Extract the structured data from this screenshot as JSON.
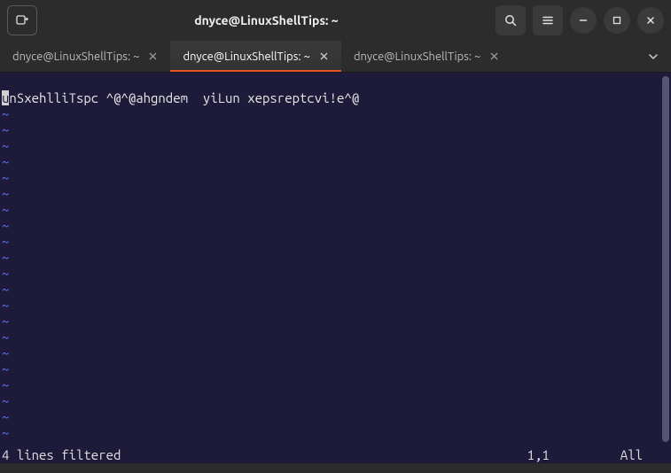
{
  "window": {
    "title": "dnyce@LinuxShellTips: ~"
  },
  "tabs": [
    {
      "label": "dnyce@LinuxShellTips: ~",
      "active": false
    },
    {
      "label": "dnyce@LinuxShellTips: ~",
      "active": true
    },
    {
      "label": "dnyce@LinuxShellTips: ~",
      "active": false
    }
  ],
  "editor": {
    "content_line": "unSxehlliTspc ^@^@ahgndem  yiLun xepsreptcvi!e^@",
    "cursor_char": "u",
    "rest_line": "nSxehlliTspc ^@^@ahgndem  yiLun xepsreptcvi!e^@",
    "tilde": "~",
    "status_message": "4 lines filtered",
    "cursor_position": "1,1",
    "scroll_position": "All"
  }
}
